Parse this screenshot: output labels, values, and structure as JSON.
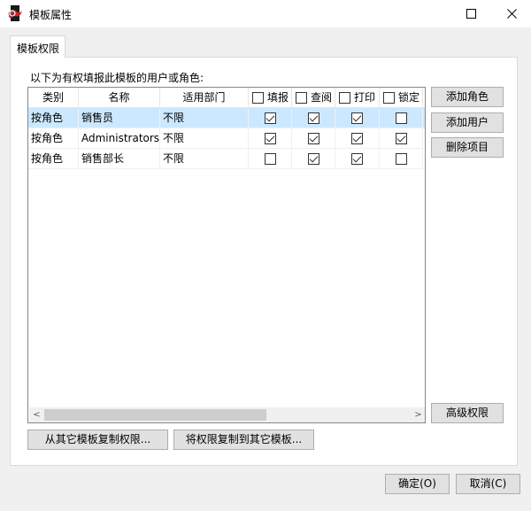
{
  "window": {
    "title": "模板属性",
    "maximize_glyph": "□",
    "close_glyph": "✕",
    "icon": "app-logo-icon"
  },
  "tabs": [
    {
      "label": "模板权限"
    }
  ],
  "panel": {
    "heading": "以下为有权填报此模板的用户或角色:",
    "columns": {
      "type": "类别",
      "name": "名称",
      "dept": "适用部门",
      "fill": "填报",
      "query": "查阅",
      "print": "打印",
      "lock": "锁定"
    },
    "rows": [
      {
        "type": "按角色",
        "name": "销售员",
        "dept": "不限",
        "fill": true,
        "query": true,
        "print": true,
        "lock": false,
        "selected": true
      },
      {
        "type": "按角色",
        "name": "Administrators",
        "dept": "不限",
        "fill": true,
        "query": true,
        "print": true,
        "lock": true,
        "selected": false
      },
      {
        "type": "按角色",
        "name": "销售部长",
        "dept": "不限",
        "fill": false,
        "query": true,
        "print": true,
        "lock": false,
        "selected": false
      }
    ],
    "scroll_left": "<",
    "scroll_right": ">",
    "buttons": {
      "add_role": "添加角色",
      "add_user": "添加用户",
      "delete_item": "删除项目",
      "advanced": "高级权限",
      "copy_from": "从其它模板复制权限...",
      "copy_to": "将权限复制到其它模板..."
    }
  },
  "footer": {
    "ok": "确定(O)",
    "cancel": "取消(C)"
  }
}
